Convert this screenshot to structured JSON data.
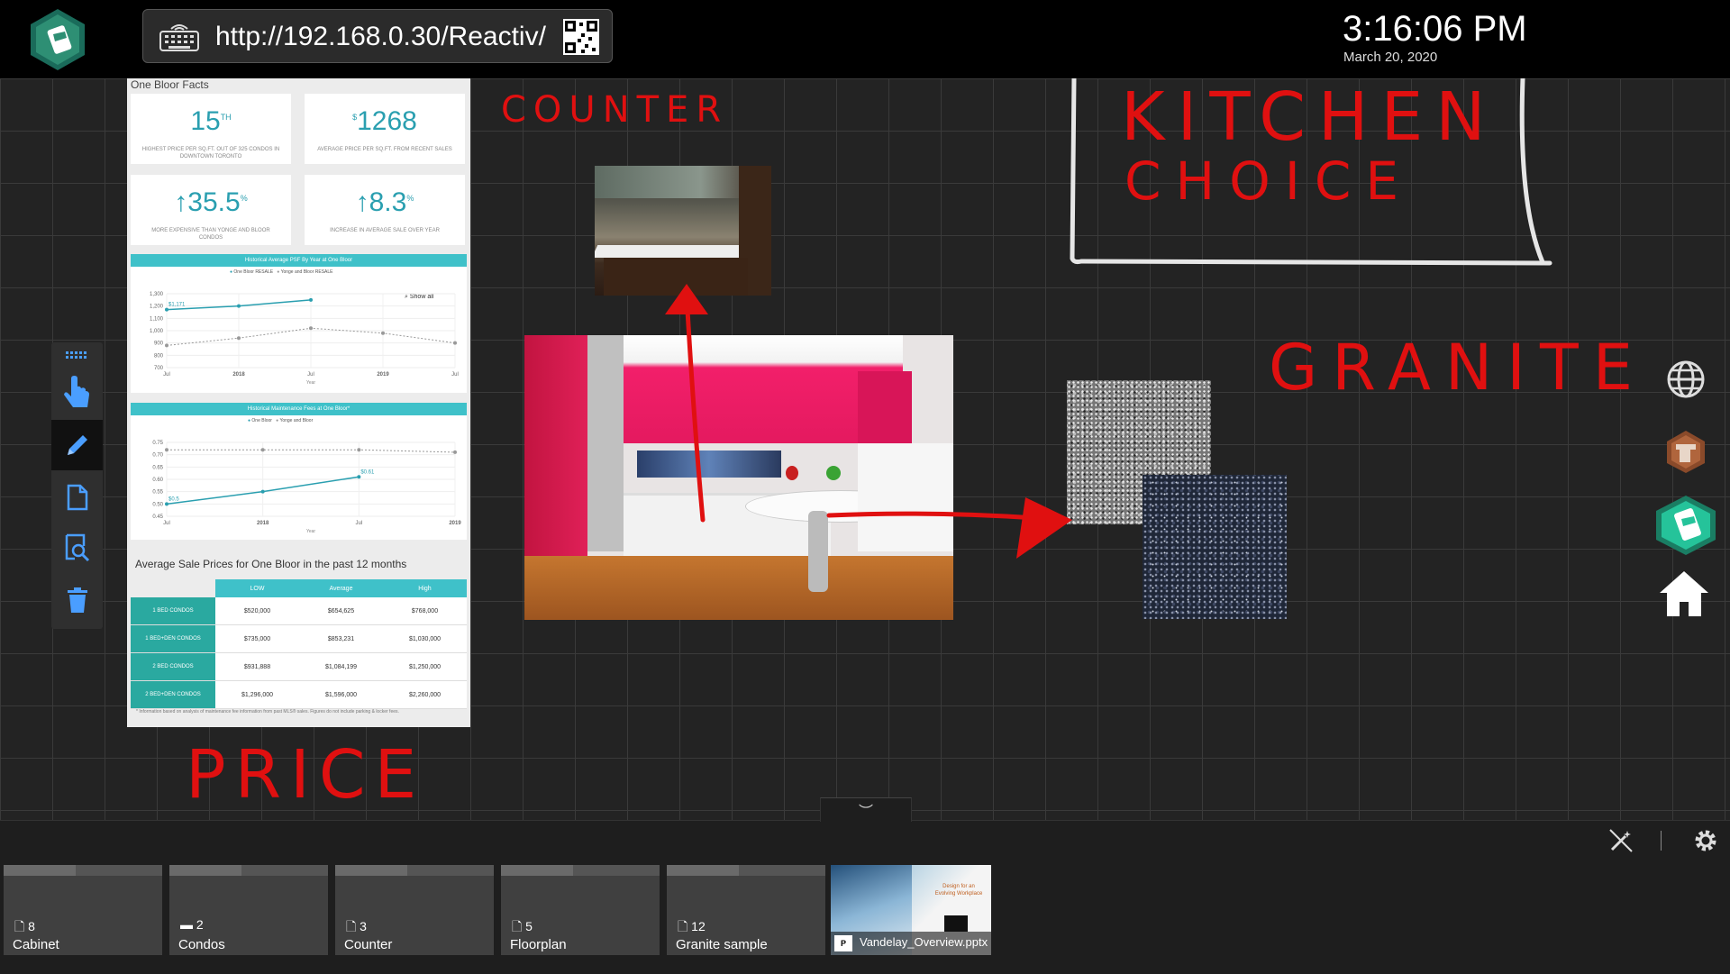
{
  "topbar": {
    "url": "http://192.168.0.30/Reactiv/",
    "time": "3:16:06 PM",
    "date": "March 20, 2020"
  },
  "annotations": {
    "counter": "COUNTER",
    "kitchen_line1": "KITCHEN",
    "kitchen_line2": "CHOICE",
    "granite": "GRANITE",
    "price": "PRICE"
  },
  "sheet": {
    "title": "One Bloor Facts",
    "stats": [
      {
        "value": "15",
        "sup": "TH",
        "desc": "HIGHEST PRICE PER SQ.FT. OUT OF 325 CONDOS IN DOWNTOWN TORONTO"
      },
      {
        "value": "1268",
        "sup": "$",
        "desc": "AVERAGE PRICE PER SQ.FT. FROM RECENT SALES"
      },
      {
        "value": "↑35.5",
        "sup": "%",
        "desc": "MORE EXPENSIVE THAN YONGE AND BLOOR CONDOS"
      },
      {
        "value": "↑8.3",
        "sup": "%",
        "desc": "INCREASE IN AVERAGE SALE OVER YEAR"
      }
    ],
    "chart1_title": "Historical Average PSF By Year at One Bloor",
    "chart1_legend_a": "One Bloor RESALE",
    "chart1_legend_b": "Yonge and Bloor RESALE",
    "chart1_label": "$1,171",
    "chart1_showall": "Show all",
    "chart1_yticks": [
      "1,300",
      "1,200",
      "1,100",
      "1,000",
      "900",
      "800",
      "700"
    ],
    "chart1_xticks": [
      "Jul",
      "2018",
      "Jul",
      "2019",
      "Jul"
    ],
    "chart2_title": "Historical Maintenance Fees at One Bloor*",
    "chart2_legend_a": "One Bloor",
    "chart2_legend_b": "Yonge and Bloor",
    "chart2_label_a": "$0.5",
    "chart2_label_b": "$0.61",
    "chart2_yticks": [
      "0.75",
      "0.70",
      "0.65",
      "0.60",
      "0.55",
      "0.50",
      "0.45"
    ],
    "chart2_xticks": [
      "Jul",
      "2018",
      "Jul",
      "2019"
    ],
    "axis_year": "Year",
    "table_title": "Average Sale Prices for One Bloor in the past 12 months",
    "table_headers": [
      "LOW",
      "Average",
      "High"
    ],
    "table_rows": [
      {
        "label": "1 BED CONDOS",
        "low": "$520,000",
        "avg": "$654,625",
        "high": "$768,000"
      },
      {
        "label": "1 BED+DEN CONDOS",
        "low": "$735,000",
        "avg": "$853,231",
        "high": "$1,030,000"
      },
      {
        "label": "2 BED CONDOS",
        "low": "$931,888",
        "avg": "$1,084,199",
        "high": "$1,250,000"
      },
      {
        "label": "2 BED+DEN CONDOS",
        "low": "$1,296,000",
        "avg": "$1,596,000",
        "high": "$2,260,000"
      }
    ],
    "footnote": "* Information based on analysis of maintenance fee information from past MLS® sales. Figures do not include parking & locker fees."
  },
  "tray": {
    "folders": [
      {
        "count": "8",
        "label": "Cabinet"
      },
      {
        "count": "2",
        "label": "Condos"
      },
      {
        "count": "3",
        "label": "Counter"
      },
      {
        "count": "5",
        "label": "Floorplan"
      },
      {
        "count": "12",
        "label": "Granite sample"
      }
    ],
    "file": {
      "label": "Vandelay_Overview.pptx",
      "thumb_text": "Design for an Evolving Workplace"
    }
  },
  "chart_data": [
    {
      "type": "line",
      "title": "Historical Average PSF By Year at One Bloor",
      "x": [
        "Jul",
        "2018",
        "Jul",
        "2019",
        "Jul"
      ],
      "series": [
        {
          "name": "One Bloor RESALE",
          "values": [
            1171,
            1200,
            1250,
            null,
            null
          ]
        },
        {
          "name": "Yonge and Bloor RESALE",
          "values": [
            880,
            940,
            1020,
            980,
            900
          ]
        }
      ],
      "ylim": [
        700,
        1300
      ]
    },
    {
      "type": "line",
      "title": "Historical Maintenance Fees at One Bloor*",
      "x": [
        "Jul",
        "2018",
        "Jul",
        "2019"
      ],
      "series": [
        {
          "name": "One Bloor",
          "values": [
            0.5,
            0.55,
            0.61,
            null
          ]
        },
        {
          "name": "Yonge and Bloor",
          "values": [
            0.72,
            0.72,
            0.72,
            0.71
          ]
        }
      ],
      "ylim": [
        0.45,
        0.75
      ]
    }
  ]
}
